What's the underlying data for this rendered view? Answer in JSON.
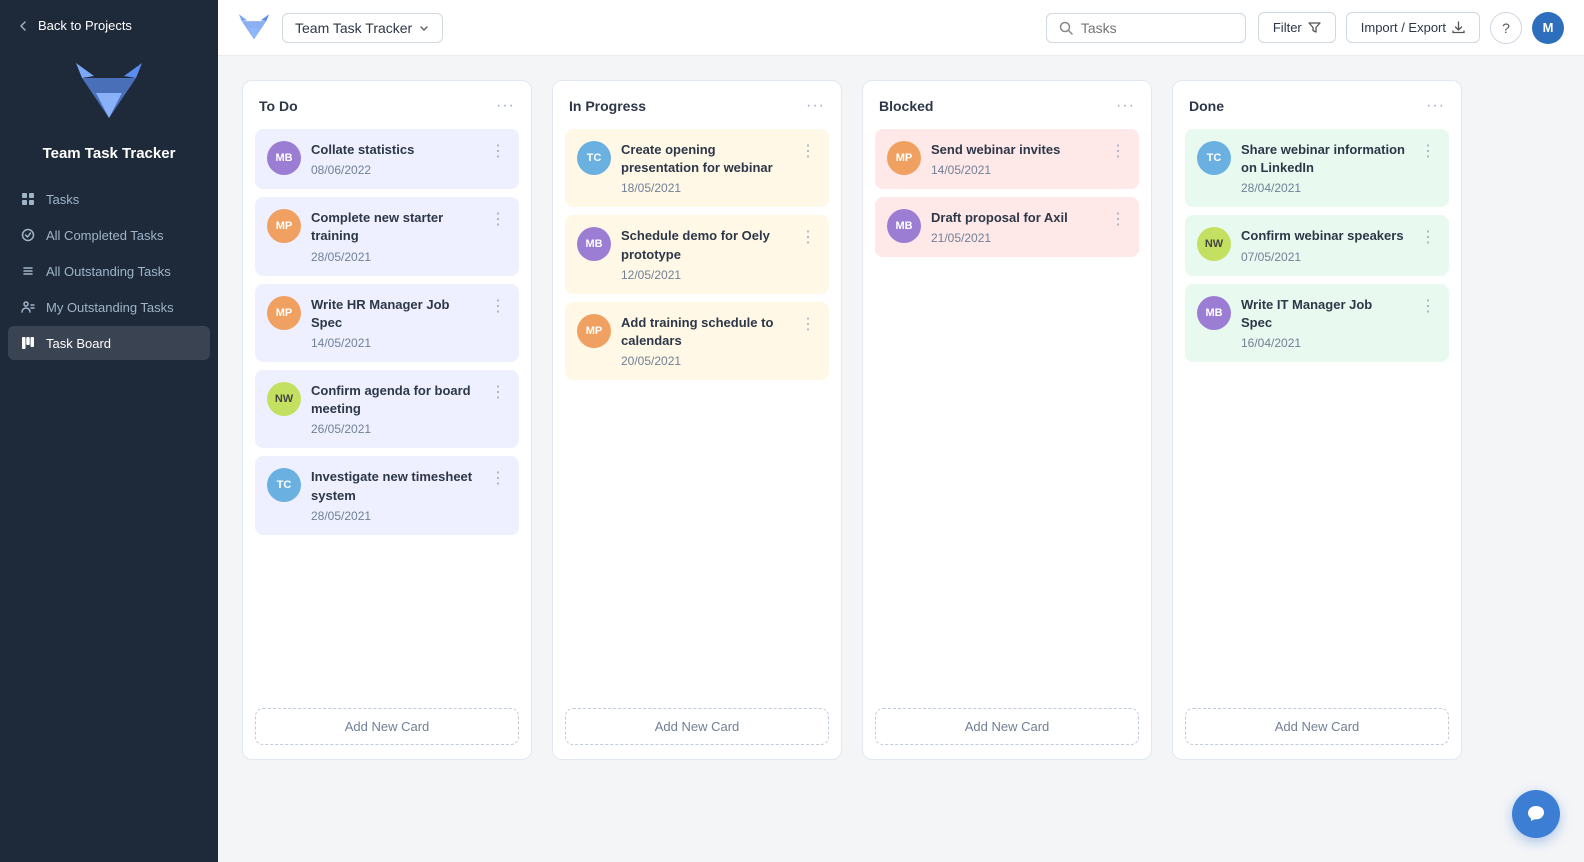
{
  "app": {
    "title": "Team Task Tracker",
    "back_label": "Back to Projects",
    "avatar_initials": "M",
    "help_label": "?"
  },
  "search": {
    "placeholder": "Tasks"
  },
  "toolbar": {
    "filter_label": "Filter",
    "import_label": "Import / Export"
  },
  "sidebar": {
    "app_name": "Team Task Tracker",
    "nav_items": [
      {
        "id": "tasks",
        "label": "Tasks",
        "icon": "grid"
      },
      {
        "id": "all-completed",
        "label": "All Completed Tasks",
        "icon": "checkmark-circle"
      },
      {
        "id": "all-outstanding",
        "label": "All Outstanding Tasks",
        "icon": "list"
      },
      {
        "id": "my-outstanding",
        "label": "My Outstanding Tasks",
        "icon": "person-list"
      },
      {
        "id": "task-board",
        "label": "Task Board",
        "icon": "board",
        "active": true
      }
    ]
  },
  "columns": [
    {
      "id": "todo",
      "title": "To Do",
      "cards": [
        {
          "id": "c1",
          "avatar": "MB",
          "avatar_class": "avatar-mb",
          "title": "Collate statistics",
          "date": "08/06/2022"
        },
        {
          "id": "c2",
          "avatar": "MP",
          "avatar_class": "avatar-mp",
          "title": "Complete new starter training",
          "date": "28/05/2021"
        },
        {
          "id": "c3",
          "avatar": "MP",
          "avatar_class": "avatar-mp",
          "title": "Write HR Manager Job Spec",
          "date": "14/05/2021"
        },
        {
          "id": "c4",
          "avatar": "NW",
          "avatar_class": "avatar-nw",
          "title": "Confirm agenda for board meeting",
          "date": "26/05/2021"
        },
        {
          "id": "c5",
          "avatar": "TC",
          "avatar_class": "avatar-tc",
          "title": "Investigate new timesheet system",
          "date": "28/05/2021"
        }
      ],
      "add_label": "Add New Card",
      "card_class": "card-todo"
    },
    {
      "id": "inprogress",
      "title": "In Progress",
      "cards": [
        {
          "id": "c6",
          "avatar": "TC",
          "avatar_class": "avatar-tc",
          "title": "Create opening presentation for webinar",
          "date": "18/05/2021"
        },
        {
          "id": "c7",
          "avatar": "MB",
          "avatar_class": "avatar-mb",
          "title": "Schedule demo for Oely prototype",
          "date": "12/05/2021"
        },
        {
          "id": "c8",
          "avatar": "MP",
          "avatar_class": "avatar-mp",
          "title": "Add training schedule to calendars",
          "date": "20/05/2021"
        }
      ],
      "add_label": "Add New Card",
      "card_class": "card-inprogress"
    },
    {
      "id": "blocked",
      "title": "Blocked",
      "cards": [
        {
          "id": "c9",
          "avatar": "MP",
          "avatar_class": "avatar-mp",
          "title": "Send webinar invites",
          "date": "14/05/2021"
        },
        {
          "id": "c10",
          "avatar": "MB",
          "avatar_class": "avatar-mb",
          "title": "Draft proposal for Axil",
          "date": "21/05/2021"
        }
      ],
      "add_label": "Add New Card",
      "card_class": "card-blocked"
    },
    {
      "id": "done",
      "title": "Done",
      "cards": [
        {
          "id": "c11",
          "avatar": "TC",
          "avatar_class": "avatar-tc",
          "title": "Share webinar information on LinkedIn",
          "date": "28/04/2021"
        },
        {
          "id": "c12",
          "avatar": "NW",
          "avatar_class": "avatar-nw",
          "title": "Confirm webinar speakers",
          "date": "07/05/2021"
        },
        {
          "id": "c13",
          "avatar": "MB",
          "avatar_class": "avatar-mb",
          "title": "Write IT Manager Job Spec",
          "date": "16/04/2021"
        }
      ],
      "add_label": "Add New Card",
      "card_class": "card-done"
    }
  ],
  "chat_fab": {
    "icon": "chat"
  }
}
